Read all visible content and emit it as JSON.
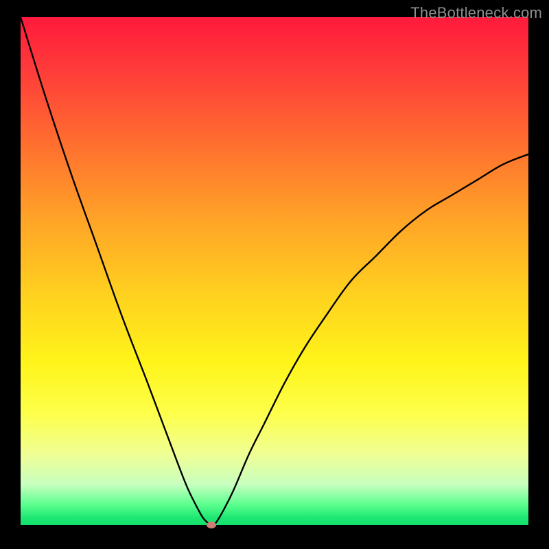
{
  "watermark": "TheBottleneck.com",
  "chart_data": {
    "type": "line",
    "title": "",
    "xlabel": "",
    "ylabel": "",
    "xlim": [
      0,
      100
    ],
    "ylim": [
      0,
      100
    ],
    "series": [
      {
        "name": "bottleneck-curve",
        "x": [
          0,
          5,
          10,
          15,
          20,
          25,
          28,
          31,
          33,
          35,
          36,
          37,
          37.5,
          38.5,
          40,
          42,
          45,
          48,
          52,
          56,
          60,
          65,
          70,
          75,
          80,
          85,
          90,
          95,
          100
        ],
        "values": [
          100,
          84,
          69,
          55,
          41,
          28,
          20,
          12,
          7,
          3,
          1.3,
          0.3,
          0,
          0.5,
          3,
          7,
          14,
          20,
          28,
          35,
          41,
          48,
          53,
          58,
          62,
          65,
          68,
          71,
          73
        ]
      }
    ],
    "marker": {
      "x": 37.5,
      "y": 0
    },
    "gradient_bands": [
      {
        "color": "green",
        "range": [
          0,
          2
        ]
      },
      {
        "color": "yellow",
        "range": [
          2,
          40
        ]
      },
      {
        "color": "orange",
        "range": [
          40,
          70
        ]
      },
      {
        "color": "red",
        "range": [
          70,
          100
        ]
      }
    ]
  }
}
